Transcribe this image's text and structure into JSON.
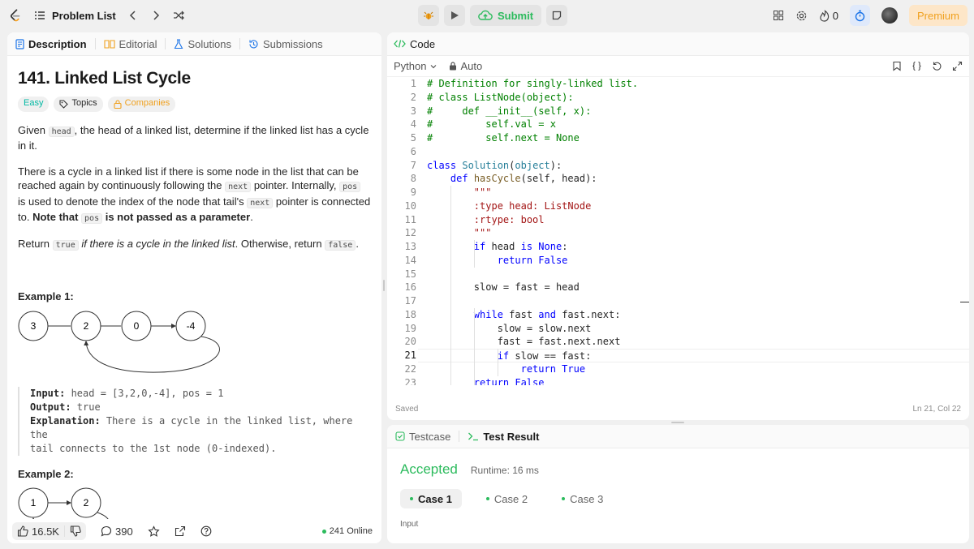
{
  "topbar": {
    "problem_list_label": "Problem List",
    "submit_label": "Submit",
    "streak_count": "0",
    "premium_label": "Premium"
  },
  "left_tabs": [
    {
      "label": "Description"
    },
    {
      "label": "Editorial"
    },
    {
      "label": "Solutions"
    },
    {
      "label": "Submissions"
    }
  ],
  "problem": {
    "title": "141. Linked List Cycle",
    "difficulty": "Easy",
    "topics_label": "Topics",
    "companies_label": "Companies",
    "p1": {
      "a": "Given ",
      "code": "head",
      "b": ", the head of a linked list, determine if the linked list has a cycle in it."
    },
    "p2": {
      "a": "There is a cycle in a linked list if there is some node in the list that can be reached again by continuously following the ",
      "code1": "next",
      "b": " pointer. Internally, ",
      "code2": "pos",
      "c": " is used to denote the index of the node that tail's ",
      "code3": "next",
      "d": " pointer is connected to. ",
      "note": "Note that ",
      "code4": "pos",
      "note2": " is not passed as a parameter",
      "e": "."
    },
    "p3": {
      "a": "Return ",
      "code1": "true",
      "em": " if there is a cycle in the linked list",
      "b": ". Otherwise, return ",
      "code2": "false",
      "c": "."
    },
    "example1": {
      "heading": "Example 1:",
      "nodes": [
        "3",
        "2",
        "0",
        "-4"
      ],
      "input_label": "Input:",
      "input": " head = [3,2,0,-4], pos = 1",
      "output_label": "Output:",
      "output": " true",
      "explanation_label": "Explanation:",
      "explanation_1": " There is a cycle in the linked list, where the",
      "explanation_2": "tail connects to the 1st node (0-indexed)."
    },
    "example2": {
      "heading": "Example 2:",
      "nodes": [
        "1",
        "2"
      ]
    }
  },
  "footer": {
    "likes": "16.5K",
    "comments": "390",
    "online": "241 Online"
  },
  "code_panel": {
    "title": "Code",
    "language": "Python",
    "mode": "Auto",
    "saved": "Saved",
    "cursor": "Ln 21, Col 22",
    "current_line": 21,
    "lines": [
      [
        [
          "cm",
          "# Definition for singly-linked list."
        ]
      ],
      [
        [
          "cm",
          "# class ListNode(object):"
        ]
      ],
      [
        [
          "cm",
          "#     def __init__(self, x):"
        ]
      ],
      [
        [
          "cm",
          "#         self.val = x"
        ]
      ],
      [
        [
          "cm",
          "#         self.next = None"
        ]
      ],
      [],
      [
        [
          "kw",
          "class "
        ],
        [
          "nm",
          "Solution"
        ],
        [
          "",
          "("
        ],
        [
          "nm",
          "object"
        ],
        [
          "",
          "):"
        ]
      ],
      [
        [
          "",
          "    "
        ],
        [
          "kw",
          "def "
        ],
        [
          "fn",
          "hasCycle"
        ],
        [
          "",
          "(self, head):"
        ]
      ],
      [
        [
          "",
          "        "
        ],
        [
          "st",
          "\"\"\""
        ]
      ],
      [
        [
          "",
          "        "
        ],
        [
          "st",
          ":type head: ListNode"
        ]
      ],
      [
        [
          "",
          "        "
        ],
        [
          "st",
          ":rtype: bool"
        ]
      ],
      [
        [
          "",
          "        "
        ],
        [
          "st",
          "\"\"\""
        ]
      ],
      [
        [
          "",
          "        "
        ],
        [
          "kw",
          "if "
        ],
        [
          "",
          "head "
        ],
        [
          "kw",
          "is None"
        ],
        [
          "",
          ":"
        ]
      ],
      [
        [
          "",
          "            "
        ],
        [
          "kw",
          "return False"
        ]
      ],
      [],
      [
        [
          "",
          "        slow = fast = head"
        ]
      ],
      [],
      [
        [
          "",
          "        "
        ],
        [
          "kw",
          "while "
        ],
        [
          "",
          "fast "
        ],
        [
          "kw",
          "and "
        ],
        [
          "",
          "fast.next:"
        ]
      ],
      [
        [
          "",
          "            slow = slow.next"
        ]
      ],
      [
        [
          "",
          "            fast = fast.next.next"
        ]
      ],
      [
        [
          "",
          "            "
        ],
        [
          "kw",
          "if "
        ],
        [
          "",
          "slow == fast:"
        ]
      ],
      [
        [
          "",
          "                "
        ],
        [
          "kw",
          "return True"
        ]
      ],
      [
        [
          "",
          "        "
        ],
        [
          "kw",
          "return False"
        ]
      ]
    ]
  },
  "result_panel": {
    "testcase_tab": "Testcase",
    "result_tab": "Test Result",
    "status": "Accepted",
    "runtime": "Runtime: 16 ms",
    "cases": [
      "Case 1",
      "Case 2",
      "Case 3"
    ],
    "input_label": "Input"
  },
  "colors": {
    "accent_green": "#2cbb5d",
    "easy": "#00b8a3",
    "premium": "#f0a11f"
  },
  "icons": [
    "leetcode-logo-icon",
    "list-icon",
    "chevron-left-icon",
    "chevron-right-icon",
    "shuffle-icon",
    "debug-icon",
    "play-icon",
    "cloud-upload-icon",
    "notes-icon",
    "layout-icon",
    "gear-icon",
    "fire-icon",
    "timer-icon",
    "description-icon",
    "editorial-icon",
    "flask-icon",
    "history-icon",
    "tag-icon",
    "lock-icon",
    "code-icon",
    "chevron-down-icon",
    "bookmark-icon",
    "braces-icon",
    "reset-icon",
    "expand-icon",
    "checkbox-icon",
    "terminal-icon",
    "thumb-up-icon",
    "thumb-down-icon",
    "comment-icon",
    "star-icon",
    "share-icon",
    "help-icon"
  ]
}
